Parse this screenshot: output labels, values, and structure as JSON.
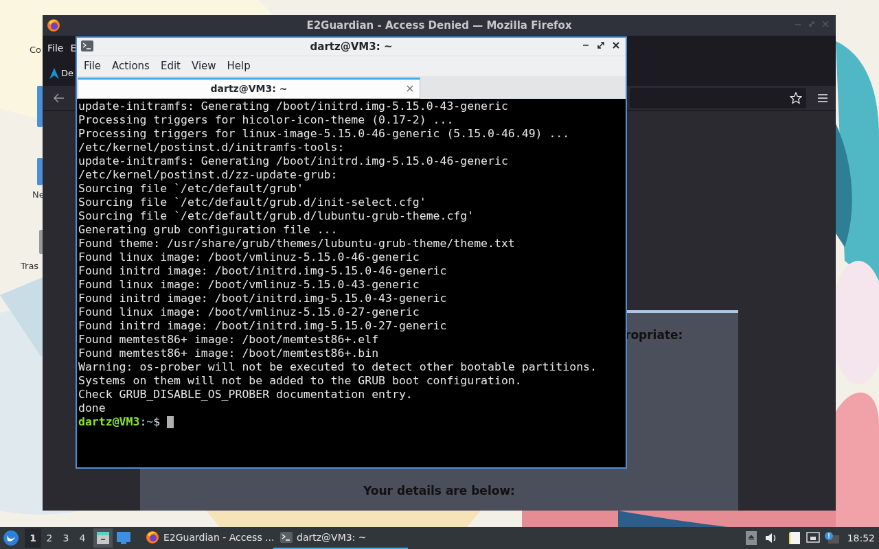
{
  "desktop": {
    "icons": [
      {
        "label": "Co"
      },
      {
        "label": "Ne"
      },
      {
        "label": "Tras"
      }
    ]
  },
  "firefox": {
    "title": "E2Guardian - Access Denied — Mozilla Firefox",
    "menu": [
      "File",
      "E"
    ],
    "tab": {
      "label": "De"
    },
    "content": {
      "heading_fragment": "ropriate:",
      "details_heading": "Your details are below:"
    }
  },
  "terminal": {
    "title": "dartz@VM3: ~",
    "menu": [
      "File",
      "Actions",
      "Edit",
      "View",
      "Help"
    ],
    "tabs": [
      {
        "label": "dartz@VM3: ~",
        "selected": true
      }
    ],
    "lines": [
      "update-initramfs: Generating /boot/initrd.img-5.15.0-43-generic",
      "Processing triggers for hicolor-icon-theme (0.17-2) ...",
      "Processing triggers for linux-image-5.15.0-46-generic (5.15.0-46.49) ...",
      "/etc/kernel/postinst.d/initramfs-tools:",
      "update-initramfs: Generating /boot/initrd.img-5.15.0-46-generic",
      "/etc/kernel/postinst.d/zz-update-grub:",
      "Sourcing file `/etc/default/grub'",
      "Sourcing file `/etc/default/grub.d/init-select.cfg'",
      "Sourcing file `/etc/default/grub.d/lubuntu-grub-theme.cfg'",
      "Generating grub configuration file ...",
      "Found theme: /usr/share/grub/themes/lubuntu-grub-theme/theme.txt",
      "Found linux image: /boot/vmlinuz-5.15.0-46-generic",
      "Found initrd image: /boot/initrd.img-5.15.0-46-generic",
      "Found linux image: /boot/vmlinuz-5.15.0-43-generic",
      "Found initrd image: /boot/initrd.img-5.15.0-43-generic",
      "Found linux image: /boot/vmlinuz-5.15.0-27-generic",
      "Found initrd image: /boot/initrd.img-5.15.0-27-generic",
      "Found memtest86+ image: /boot/memtest86+.elf",
      "Found memtest86+ image: /boot/memtest86+.bin",
      "Warning: os-prober will not be executed to detect other bootable partitions.",
      "Systems on them will not be added to the GRUB boot configuration.",
      "Check GRUB_DISABLE_OS_PROBER documentation entry.",
      "done"
    ],
    "prompt": {
      "user_host": "dartz@VM3",
      "separator": ":",
      "path": "~",
      "symbol": "$"
    }
  },
  "taskbar": {
    "desktops": [
      {
        "label": "1",
        "selected": true
      },
      {
        "label": "2",
        "selected": false
      },
      {
        "label": "3",
        "selected": false
      },
      {
        "label": "4",
        "selected": false
      }
    ],
    "tasks": [
      {
        "kind": "firefox",
        "label": "E2Guardian - Access ...",
        "selected": false
      },
      {
        "kind": "terminal",
        "label": "dartz@VM3: ~",
        "selected": true
      }
    ],
    "clock": "18:52"
  }
}
